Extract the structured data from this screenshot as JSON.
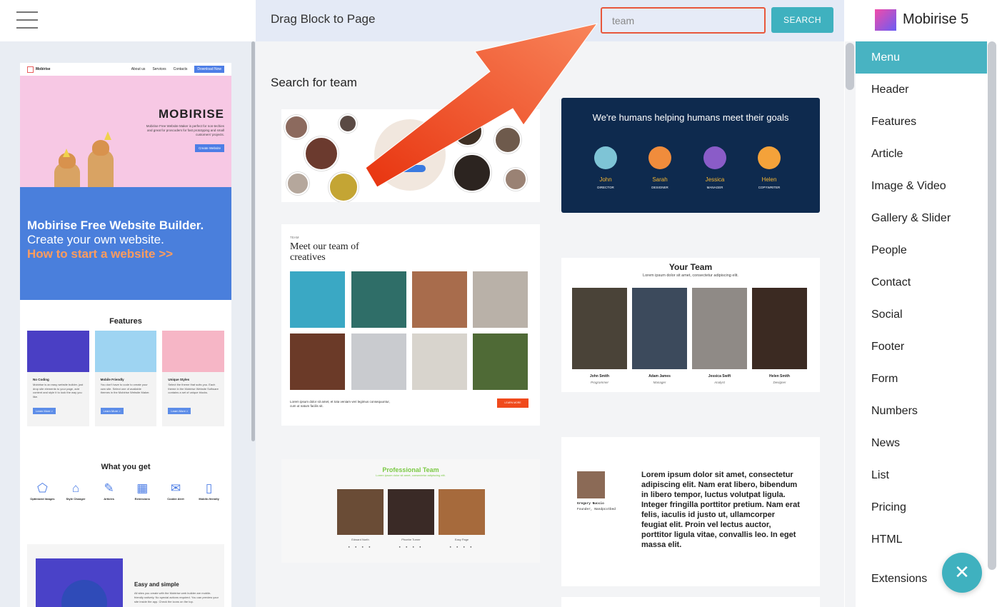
{
  "topbar": {
    "title": "Drag Block to Page",
    "search_value": "team",
    "search_button": "SEARCH"
  },
  "brand": {
    "name": "Mobirise 5"
  },
  "results_title": "Search for team",
  "preview": {
    "nav_brand": "Mobirise",
    "nav_links": [
      "About us",
      "Services",
      "Contacts"
    ],
    "nav_button": "Download Now",
    "hero_title": "MOBIRISE",
    "hero_text": "Mobirise Free Website Maker is perfect for non-techies and great for proscoders for fast prototyping and small customers' projects.",
    "hero_button": "Create Website",
    "banner_line1": "Mobirise Free Website Builder.",
    "banner_line2": "Create your own website.",
    "banner_line3": "How to start a website >>",
    "features_title": "Features",
    "features": [
      {
        "title": "No Coding",
        "text": "Mobirise is an easy website builder, just drop site elements to your page, add content and style it to look the way you like.",
        "button": "Learn More >"
      },
      {
        "title": "Mobile Friendly",
        "text": "You don't have to code to create your own site. Select one of available themes in the Mobirise Website Maker.",
        "button": "Learn More >"
      },
      {
        "title": "Unique Styles",
        "text": "Select the theme that suits you. Each theme in the Mobirise Website Software contains a set of unique blocks.",
        "button": "Learn More >"
      }
    ],
    "get_title": "What you get",
    "get_items": [
      "Optimized Images",
      "Style Changer",
      "Articles",
      "Extensions",
      "Cookie Alert",
      "Mobile-friendly"
    ],
    "easy_title": "Easy and simple",
    "easy_text": "All sites you create with the Mobirise web builder are mobile-friendly natively. No special actions required. You can preview your site inside the app. Check the icons on the top."
  },
  "blocks": {
    "dark_team": {
      "heading": "We're humans helping humans meet their goals",
      "members": [
        {
          "name": "John",
          "role": "DIRECTOR"
        },
        {
          "name": "Sarah",
          "role": "DESIGNER"
        },
        {
          "name": "Jessica",
          "role": "MANAGER"
        },
        {
          "name": "Helen",
          "role": "COPYWRITER"
        }
      ]
    },
    "creatives": {
      "eyebrow": "TEAM",
      "title": "Meet our team of creatives",
      "caption": "Lorem ipsum dolor sit amet, et tota veniam veri legimus consequuntur, cum ut natum facilis sit.",
      "button": "LEARN MORE"
    },
    "your_team": {
      "title": "Your Team",
      "subtitle": "Lorem ipsum dolor sit amet, consectetur adipiscing elit.",
      "people": [
        {
          "name": "John Smith",
          "role": "Programmer"
        },
        {
          "name": "Adam James",
          "role": "Manager"
        },
        {
          "name": "Jessica Swift",
          "role": "Analyst"
        },
        {
          "name": "Helen Smith",
          "role": "Designer"
        }
      ]
    },
    "pro_team": {
      "title": "Professional Team",
      "subtitle": "Lorem ipsum dolor sit amet, consectetur adipiscing elit.",
      "names": [
        "Edward North",
        "Phoebe Turner",
        "Easy Page"
      ]
    },
    "bio": {
      "name": "Gregory Nuccio",
      "role": "Founder, Nandpcotbed",
      "text": "Lorem ipsum dolor sit amet, consectetur adipiscing elit. Nam erat libero, bibendum in libero tempor, luctus volutpat ligula. Integer fringilla porttitor pretium. Nam erat felis, iaculis id justo ut, ullamcorper feugiat elit. Proin vel lectus auctor, porttitor ligula vitae, convallis leo. In eget massa elit."
    }
  },
  "categories": [
    "Menu",
    "Header",
    "Features",
    "Article",
    "Image & Video",
    "Gallery & Slider",
    "People",
    "Contact",
    "Social",
    "Footer",
    "Form",
    "Numbers",
    "News",
    "List",
    "Pricing",
    "HTML",
    "Extensions"
  ],
  "active_category": "Menu",
  "fab_icon": "close-icon",
  "colors": {
    "accent": "#3fb1bf",
    "highlight": "#e8573b",
    "arrow": "#f3582c"
  }
}
